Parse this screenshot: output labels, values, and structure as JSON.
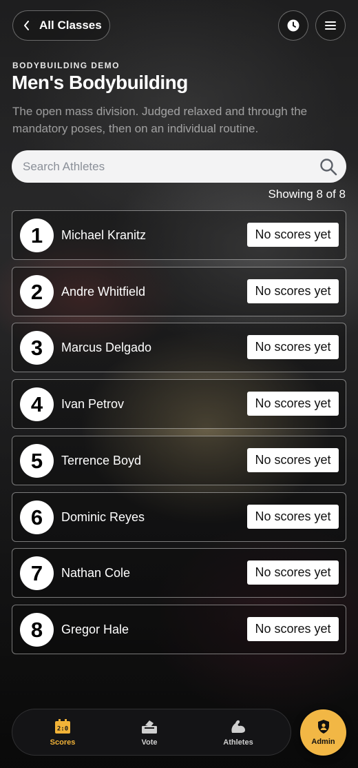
{
  "header": {
    "back_label": "All Classes",
    "eyebrow": "BODYBUILDING DEMO",
    "title": "Men's Bodybuilding",
    "description": "The open mass division. Judged relaxed and through the mandatory poses, then on an individual routine."
  },
  "search": {
    "placeholder": "Search Athletes",
    "value": ""
  },
  "results": {
    "showing_text": "Showing 8 of 8"
  },
  "athletes": [
    {
      "rank": "1",
      "name": "Michael Kranitz",
      "status": "No scores yet"
    },
    {
      "rank": "2",
      "name": "Andre Whitfield",
      "status": "No scores yet"
    },
    {
      "rank": "3",
      "name": "Marcus Delgado",
      "status": "No scores yet"
    },
    {
      "rank": "4",
      "name": "Ivan Petrov",
      "status": "No scores yet"
    },
    {
      "rank": "5",
      "name": "Terrence Boyd",
      "status": "No scores yet"
    },
    {
      "rank": "6",
      "name": "Dominic Reyes",
      "status": "No scores yet"
    },
    {
      "rank": "7",
      "name": "Nathan Cole",
      "status": "No scores yet"
    },
    {
      "rank": "8",
      "name": "Gregor Hale",
      "status": "No scores yet"
    }
  ],
  "nav": {
    "items": [
      {
        "label": "Scores",
        "icon": "scoreboard-icon",
        "active": true
      },
      {
        "label": "Vote",
        "icon": "ballot-box-icon",
        "active": false
      },
      {
        "label": "Athletes",
        "icon": "flexed-arm-icon",
        "active": false
      }
    ],
    "admin_label": "Admin",
    "admin_icon": "shield-user-icon"
  },
  "colors": {
    "accent": "#f2b745",
    "active_nav": "#f2b338",
    "background": "#161617"
  }
}
